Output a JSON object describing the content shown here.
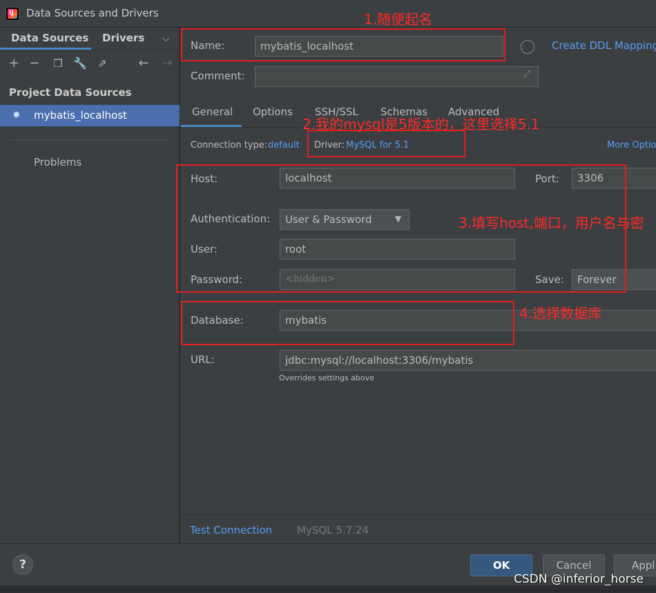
{
  "window": {
    "title": "Data Sources and Drivers"
  },
  "left": {
    "tabs": [
      "Data Sources",
      "Drivers"
    ],
    "toolbar_icons": [
      "add-icon",
      "remove-icon",
      "copy-icon",
      "wrench-icon",
      "open-icon",
      "back-icon",
      "forward-icon"
    ],
    "section_title": "Project Data Sources",
    "selected_item": "mybatis_localhost",
    "problems": "Problems"
  },
  "form": {
    "name_label": "Name:",
    "name_value": "mybatis_localhost",
    "create_ddl_link": "Create DDL Mapping",
    "comment_label": "Comment:",
    "comment_value": "",
    "tabs": [
      "General",
      "Options",
      "SSH/SSL",
      "Schemas",
      "Advanced"
    ],
    "connection_type_label": "Connection type:",
    "connection_type_value": "default",
    "driver_label": "Driver:",
    "driver_value": "MySQL for 5.1",
    "more_options": "More Optio",
    "host_label": "Host:",
    "host_value": "localhost",
    "port_label": "Port:",
    "port_value": "3306",
    "auth_label": "Authentication:",
    "auth_value": "User & Password",
    "user_label": "User:",
    "user_value": "root",
    "password_label": "Password:",
    "password_placeholder": "<hidden>",
    "save_label": "Save:",
    "save_value": "Forever",
    "database_label": "Database:",
    "database_value": "mybatis",
    "url_label": "URL:",
    "url_value": "jdbc:mysql://localhost:3306/mybatis",
    "url_hint": "Overrides settings above",
    "test_connection": "Test Connection",
    "server_version": "MySQL 5.7.24"
  },
  "annotations": {
    "note1": "1.随便起名",
    "note2": "2.我的mysql是5版本的，这里选择5.1",
    "note3": "3.填写host,端口，用户名与密",
    "note4": "4.选择数据库"
  },
  "footer": {
    "help": "?",
    "ok": "OK",
    "cancel": "Cancel",
    "apply": "Appl"
  },
  "watermark": "CSDN @inferior_horse",
  "colors": {
    "accent": "#4a88c7",
    "link": "#589df6",
    "annotation_red": "#e11f1f",
    "selection": "#4b6eaf"
  }
}
